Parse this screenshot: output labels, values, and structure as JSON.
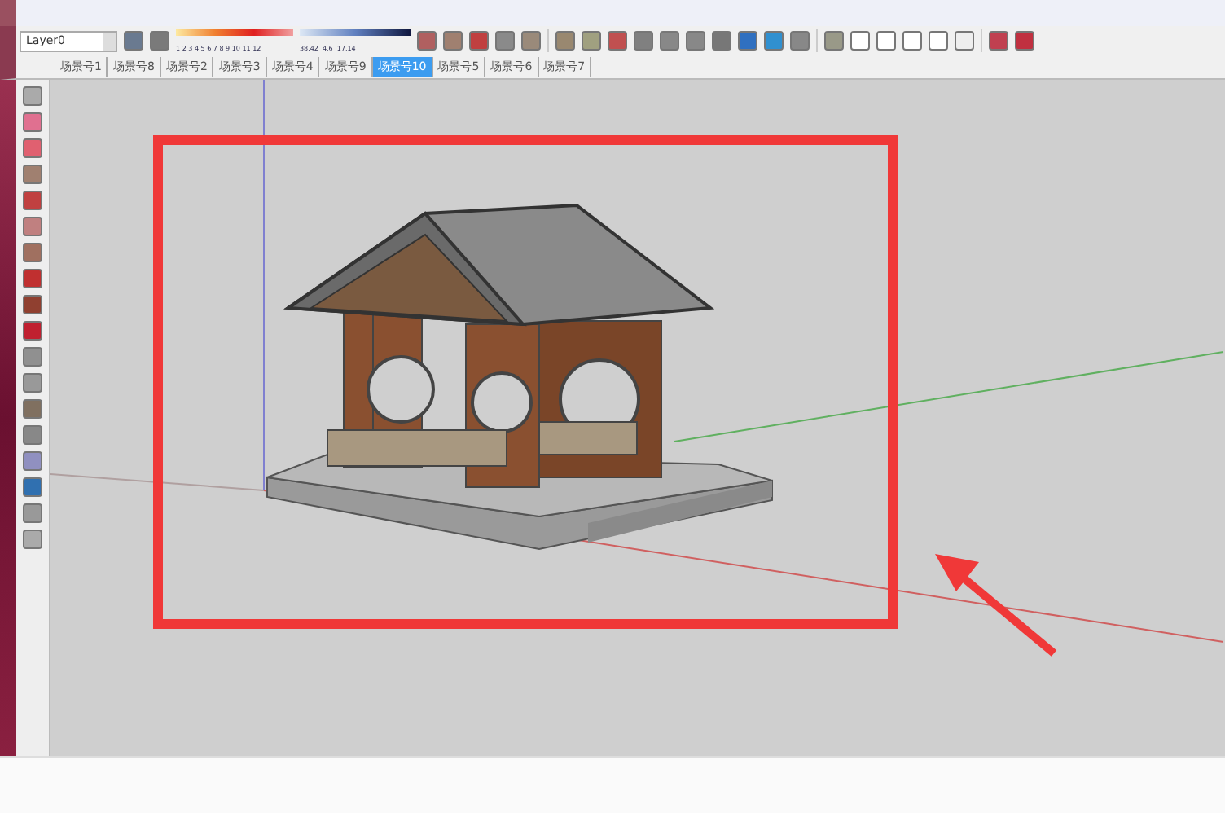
{
  "layer_select": {
    "value": "Layer0"
  },
  "style_scales": [
    {
      "kind": "warm",
      "labels": "1 2 3 4 5 6 7 8 9 10 11 12"
    },
    {
      "kind": "cool",
      "labels": "38.42  4.6  17.14"
    }
  ],
  "scene_tabs": [
    {
      "label": "场景号1",
      "selected": false
    },
    {
      "label": "场景号8",
      "selected": false
    },
    {
      "label": "场景号2",
      "selected": false
    },
    {
      "label": "场景号3",
      "selected": false
    },
    {
      "label": "场景号4",
      "selected": false
    },
    {
      "label": "场景号9",
      "selected": false
    },
    {
      "label": "场景号10",
      "selected": true
    },
    {
      "label": "场景号5",
      "selected": false
    },
    {
      "label": "场景号6",
      "selected": false
    },
    {
      "label": "场景号7",
      "selected": false
    }
  ]
}
